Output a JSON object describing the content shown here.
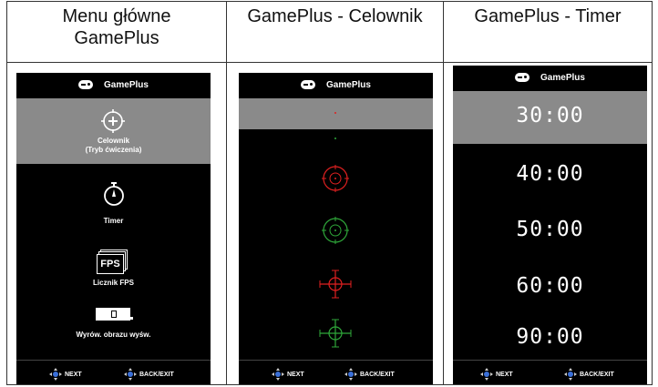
{
  "headers": {
    "col1_line1": "Menu główne",
    "col1_line2": "GamePlus",
    "col2": "GamePlus - Celownik",
    "col3": "GamePlus - Timer"
  },
  "panel_title": "GamePlus",
  "main_menu": {
    "items": [
      {
        "label_line1": "Celownik",
        "label_line2": "(Tryb ćwiczenia)",
        "icon": "crosshair-icon"
      },
      {
        "label_line1": "Timer",
        "icon": "stopwatch-icon"
      },
      {
        "label_line1": "Licznik FPS",
        "icon": "fps-icon",
        "icon_text": "FPS"
      },
      {
        "label_line1": "Wyrów. obrazu wyśw.",
        "icon": "display-align-icon"
      }
    ],
    "selected_index": 0
  },
  "crosshair_menu": {
    "options": [
      "red-dot-crosshair",
      "green-dot-crosshair",
      "red-circle-crosshair",
      "green-circle-crosshair",
      "red-cross-crosshair",
      "green-cross-crosshair"
    ],
    "colors": {
      "red": "#e02020",
      "green": "#2fa83a"
    },
    "selected_index": 0
  },
  "timer_menu": {
    "options": [
      "30:00",
      "40:00",
      "50:00",
      "60:00",
      "90:00"
    ],
    "selected_index": 0
  },
  "footer": {
    "next_label": "NEXT",
    "back_label": "BACK/EXIT"
  },
  "colors": {
    "selection": "#8a8a8a",
    "panel_bg": "#000000",
    "dpad_blue": "#3a6fd8"
  }
}
